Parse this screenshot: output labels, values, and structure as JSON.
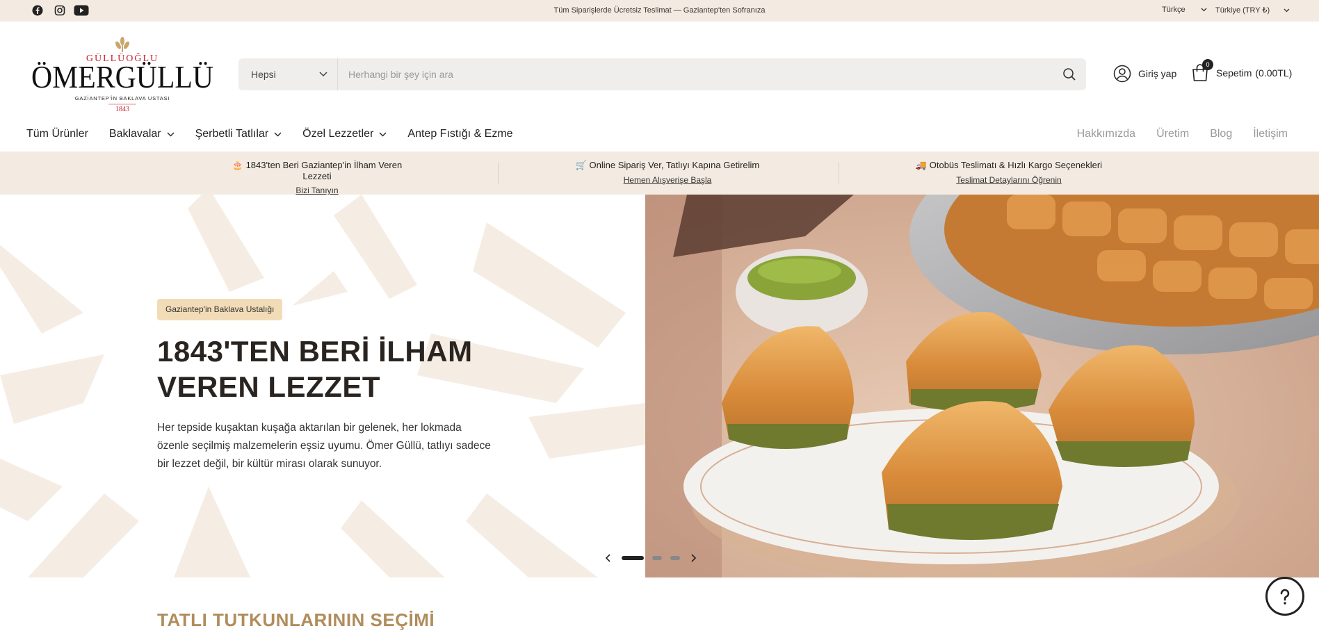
{
  "topbar": {
    "social": [
      "facebook-icon",
      "instagram-icon",
      "youtube-icon"
    ],
    "message": "Tüm Siparişlerde Ücretsiz Teslimat — Gaziantep'ten Sofranıza",
    "language": "Türkçe",
    "currency": "Türkiye (TRY ₺)"
  },
  "logo": {
    "top": "GÜLLÜOĞLU",
    "name": "ÖMERGÜLLÜ",
    "tagline": "GAZİANTEP'İN BAKLAVA USTASI",
    "year": "1843"
  },
  "search": {
    "category": "Hepsi",
    "placeholder": "Herhangi bir şey için ara"
  },
  "account": {
    "login": "Giriş yap",
    "cart_label": "Sepetim",
    "cart_total": "(0.00TL)",
    "cart_count": "0"
  },
  "nav": {
    "left": [
      {
        "label": "Tüm Ürünler",
        "dropdown": false
      },
      {
        "label": "Baklavalar",
        "dropdown": true
      },
      {
        "label": "Şerbetli Tatlılar",
        "dropdown": true
      },
      {
        "label": "Özel Lezzetler",
        "dropdown": true
      },
      {
        "label": "Antep Fıstığı & Ezme",
        "dropdown": false
      }
    ],
    "right": [
      "Hakkımızda",
      "Üretim",
      "Blog",
      "İletişim"
    ]
  },
  "info": [
    {
      "emoji": "🎂",
      "title": "1843'ten Beri Gaziantep'in İlham Veren Lezzeti",
      "link": "Bizi Tanıyın"
    },
    {
      "emoji": "🛒",
      "title": "Online Sipariş Ver, Tatlıyı Kapına Getirelim",
      "link": "Hemen Alışverişe Başla"
    },
    {
      "emoji": "🚚",
      "title": "Otobüs Teslimatı & Hızlı Kargo Seçenekleri",
      "link": "Teslimat Detaylarını Öğrenin"
    }
  ],
  "hero": {
    "badge": "Gaziantep'in Baklava Ustalığı",
    "title": "1843'TEN BERİ İLHAM VEREN LEZZET",
    "text": "Her tepside kuşaktan kuşağa aktarılan bir gelenek, her lokmada özenle seçilmiş malzemelerin eşsiz uyumu. Ömer Güllü, tatlıyı sadece bir lezzet değil, bir kültür mirası olarak sunuyor.",
    "slides_total": 3,
    "active_slide": 1
  },
  "section": {
    "title": "TATLI TUTKUNLARININ SEÇİMİ"
  },
  "colors": {
    "cream": "#f3ebe1",
    "badge": "#f2dcb7",
    "logo_red": "#c8202e",
    "gold": "#b08d5c"
  }
}
